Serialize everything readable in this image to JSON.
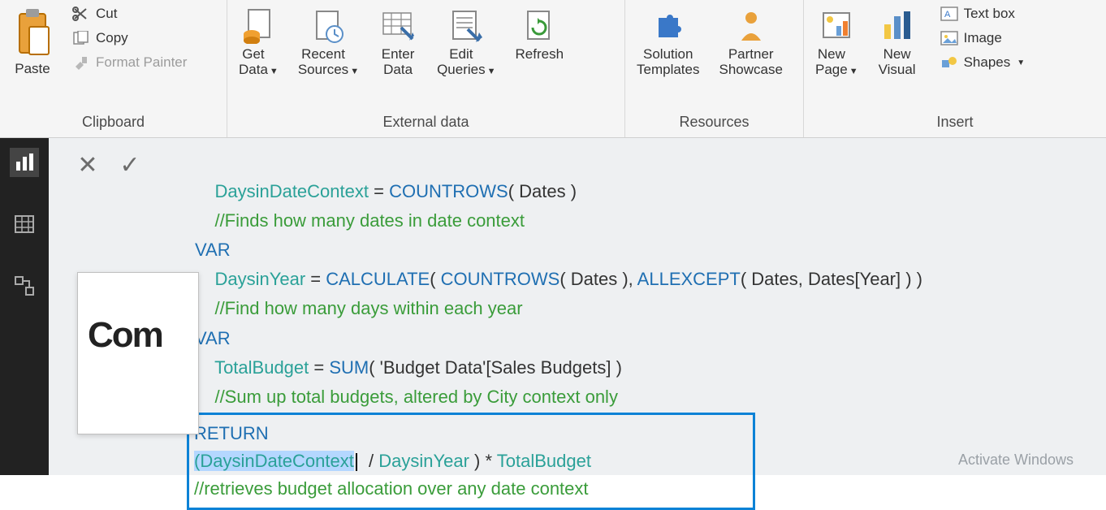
{
  "ribbon": {
    "clipboard": {
      "label": "Clipboard",
      "paste": "Paste",
      "cut": "Cut",
      "copy": "Copy",
      "format_painter": "Format Painter"
    },
    "external_data": {
      "label": "External data",
      "get_data": "Get\nData",
      "recent_sources": "Recent\nSources",
      "enter_data": "Enter\nData",
      "edit_queries": "Edit\nQueries",
      "refresh": "Refresh"
    },
    "resources": {
      "label": "Resources",
      "solution_templates": "Solution\nTemplates",
      "partner_showcase": "Partner\nShowcase"
    },
    "insert": {
      "label": "Insert",
      "new_page": "New\nPage",
      "new_visual": "New\nVisual",
      "text_box": "Text box",
      "image": "Image",
      "shapes": "Shapes"
    }
  },
  "code": {
    "l1_id": "DaysinDateContext",
    "l1_eq": " = ",
    "l1_fn": "COUNTROWS",
    "l1_args": "( Dates )",
    "l2_cm": "//Finds how many dates in date context",
    "l3_kw": "VAR",
    "l4_id": "DaysinYear",
    "l4_eq": " = ",
    "l4_fn1": "CALCULATE",
    "l4_open": "( ",
    "l4_fn2": "COUNTROWS",
    "l4_args2": "( Dates ), ",
    "l4_fn3": "ALLEXCEPT",
    "l4_args3": "( Dates, Dates[Year] ) )",
    "l5_cm": "//Find how many days within each year",
    "l6_kw": "VAR",
    "l7_id": "TotalBudget",
    "l7_eq": " = ",
    "l7_fn": "SUM",
    "l7_args": "( 'Budget Data'[Sales Budgets] )",
    "l8_cm": "//Sum up total budgets, altered by City context only",
    "l9_kw": "RETURN",
    "l10_open": "(",
    "l10_a": "DaysinDateContext",
    "l10_div": " / ",
    "l10_b": "DaysinYear",
    "l10_mid": " ) * ",
    "l10_c": "TotalBudget",
    "l11_cm": "//retrieves budget allocation over any date context"
  },
  "page": {
    "title": "Com"
  },
  "watermark": "Activate Windows"
}
